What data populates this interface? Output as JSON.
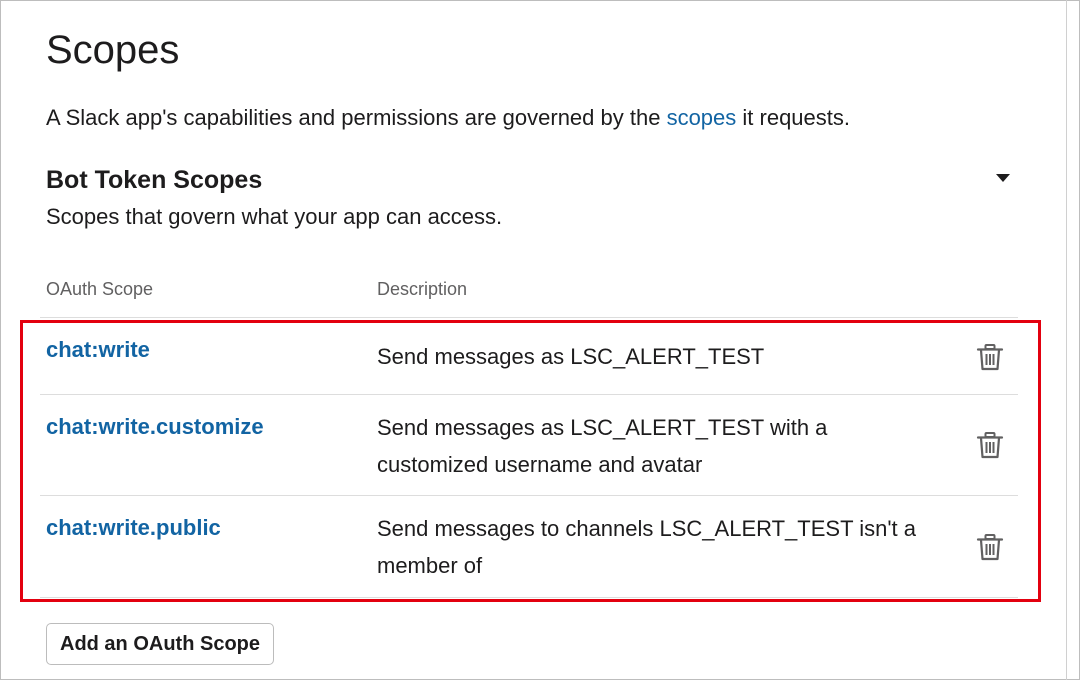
{
  "page": {
    "title": "Scopes",
    "intro_before": "A Slack app's capabilities and permissions are governed by the ",
    "intro_link": "scopes",
    "intro_after": " it requests."
  },
  "section": {
    "title": "Bot Token Scopes",
    "subtitle": "Scopes that govern what your app can access.",
    "toggle_icon": "caret-down-icon"
  },
  "table": {
    "headers": {
      "scope": "OAuth Scope",
      "description": "Description"
    },
    "rows": [
      {
        "scope": "chat:write",
        "description": "Send messages as LSC_ALERT_TEST",
        "action_icon": "trash-icon"
      },
      {
        "scope": "chat:write.customize",
        "description": "Send messages as LSC_ALERT_TEST with a customized username and avatar",
        "action_icon": "trash-icon"
      },
      {
        "scope": "chat:write.public",
        "description": "Send messages to channels LSC_ALERT_TEST isn't a member of",
        "action_icon": "trash-icon"
      }
    ]
  },
  "actions": {
    "add_scope_label": "Add an OAuth Scope"
  },
  "colors": {
    "link": "#1264a3",
    "highlight_border": "#e3000f",
    "text": "#1d1c1d",
    "muted": "#616061"
  }
}
